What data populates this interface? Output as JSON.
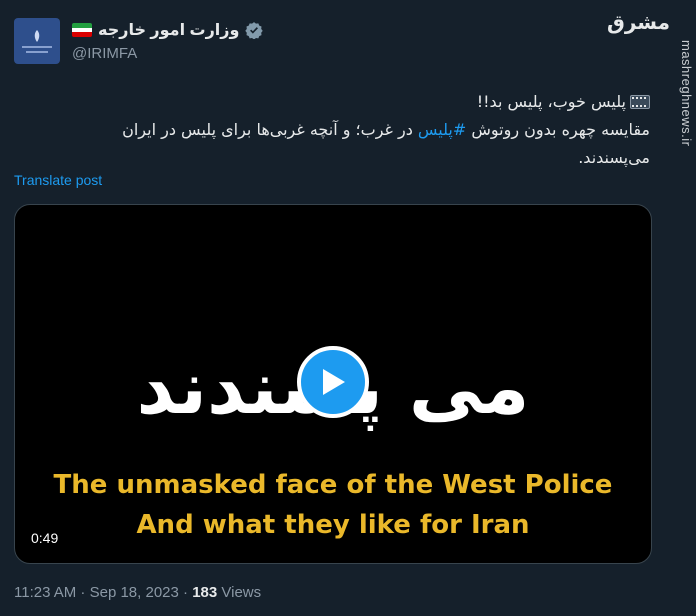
{
  "account": {
    "name": "وزارت امور خارجه",
    "handle": "@IRIMFA"
  },
  "watermark": {
    "logo": "مشرق",
    "site": "mashreghnews.ir"
  },
  "tweet": {
    "line1": "پلیس خوب، پلیس بد!!",
    "line2_before": "مقایسه چهره بدون روتوش ",
    "hashtag": "#پلیس",
    "line2_after": " در غرب؛ و آنچه غربی‌ها برای پلیس در ایران",
    "line3": "می‌پسندند."
  },
  "translate_label": "Translate post",
  "video": {
    "farsi_text": "می پسندند",
    "english_line1": "The unmasked face of the West Police",
    "english_line2": "And what they like for Iran",
    "duration": "0:49"
  },
  "meta": {
    "time": "11:23 AM",
    "sep1": " · ",
    "date": "Sep 18, 2023",
    "sep2": " · ",
    "views_count": "183",
    "views_label": " Views"
  },
  "colors": {
    "background": "#15202b",
    "accent": "#1d9bf0",
    "caption_yellow": "#eab82a"
  }
}
